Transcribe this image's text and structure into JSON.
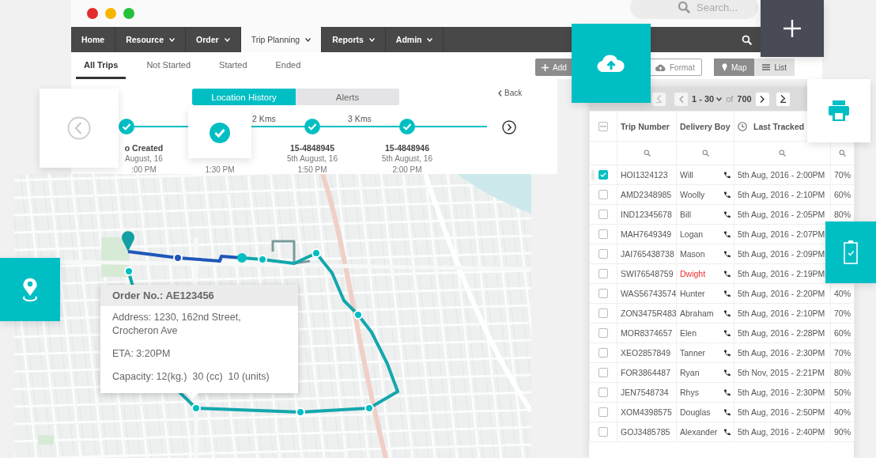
{
  "window": {
    "search": {
      "placeholder": "Search..."
    }
  },
  "nav": [
    {
      "label": "Home",
      "dropdown": false,
      "selected": false
    },
    {
      "label": "Resource",
      "dropdown": true,
      "selected": false
    },
    {
      "label": "Order",
      "dropdown": true,
      "selected": false
    },
    {
      "label": "Trip Planning",
      "dropdown": true,
      "selected": true
    },
    {
      "label": "Reports",
      "dropdown": true,
      "selected": false
    },
    {
      "label": "Admin",
      "dropdown": true,
      "selected": false
    }
  ],
  "sub_tabs": [
    {
      "label": "All Trips",
      "selected": true
    },
    {
      "label": "Not Started",
      "selected": false
    },
    {
      "label": "Started",
      "selected": false
    },
    {
      "label": "Ended",
      "selected": false
    }
  ],
  "toolbar": {
    "buttons": [
      {
        "label": "Add",
        "kind": "add"
      },
      {
        "label": "Format",
        "kind": "format"
      }
    ],
    "view_toggle": [
      {
        "label": "Map",
        "selected": true
      },
      {
        "label": "List",
        "selected": false
      }
    ]
  },
  "timeline": {
    "tabs": [
      {
        "label": "Location History",
        "selected": true
      },
      {
        "label": "Alerts",
        "selected": false
      }
    ],
    "back": "Back",
    "distances": [
      "2 Kms",
      "3 Kms"
    ],
    "stops": [
      {
        "title": "o Created",
        "date": "August, 16",
        "time": ":00 PM",
        "done": true
      },
      {
        "time": "1:30 PM"
      },
      {
        "title": "15-4848945",
        "date": "5th August, 16",
        "time": "1:50 PM",
        "done": true
      },
      {
        "title": "15-4848946",
        "date": "5th August, 16",
        "time": "2:00 PM",
        "done": true
      }
    ]
  },
  "tooltip": {
    "title": "Order No.: AE123456",
    "lines": [
      "Address: 1230, 162nd Street, Crocheron Ave",
      "ETA: 3:20PM",
      "Capacity: 12(kg.)  30 (cc)  10 (units)"
    ]
  },
  "table": {
    "pagination": {
      "range": "1 - 30",
      "of": "of",
      "total": "700"
    },
    "select_all_partial": true,
    "columns": [
      "Trip Number",
      "Delivery Boy",
      "Last Tracked"
    ],
    "rows": [
      {
        "trip": "HOI1324123",
        "boy": "Will",
        "alert": false,
        "tracked": "5th Aug, 2016 - 2:00PM",
        "percent": "70%",
        "selected": true
      },
      {
        "trip": "AMD2348985",
        "boy": "Woolly",
        "alert": false,
        "tracked": "5th Aug, 2016 - 2:10PM",
        "percent": "60%",
        "selected": false
      },
      {
        "trip": "IND12345678",
        "boy": "Bill",
        "alert": false,
        "tracked": "5th Aug, 2016 - 2:05PM",
        "percent": "80%",
        "selected": false
      },
      {
        "trip": "MAH7649349",
        "boy": "Logan",
        "alert": false,
        "tracked": "5th Aug, 2016 - 2:07PM",
        "selected": false
      },
      {
        "trip": "JAI765438738",
        "boy": "Mason",
        "alert": false,
        "tracked": "5th Aug, 2016 - 2:09PM",
        "selected": false
      },
      {
        "trip": "SWI76548759",
        "boy": "Dwight",
        "alert": true,
        "tracked": "5th Aug, 2016 - 2:19PM",
        "selected": false
      },
      {
        "trip": "WAS56743574",
        "boy": "Hunter",
        "alert": false,
        "tracked": "5th Aug, 2016 - 2:20PM",
        "percent": "40%",
        "selected": false
      },
      {
        "trip": "ZON3475R483",
        "boy": "Abraham",
        "alert": false,
        "tracked": "5th Aug, 2016 - 2:10PM",
        "percent": "70%",
        "selected": false
      },
      {
        "trip": "MOR8374657",
        "boy": "Elen",
        "alert": false,
        "tracked": "5th Aug, 2016 - 2:28PM",
        "percent": "60%",
        "selected": false
      },
      {
        "trip": "XEO2857849",
        "boy": "Tanner",
        "alert": false,
        "tracked": "5th Aug, 2016 - 2:30PM",
        "percent": "70%",
        "selected": false
      },
      {
        "trip": "FOR3864487",
        "boy": "Ryan",
        "alert": false,
        "tracked": "5th Nov, 2015 - 2:21PM",
        "percent": "80%",
        "selected": false
      },
      {
        "trip": "JEN7548734",
        "boy": "Rhys",
        "alert": false,
        "tracked": "5th Aug, 2016 - 2:30PM",
        "percent": "50%",
        "selected": false
      },
      {
        "trip": "XOM4398575",
        "boy": "Douglas",
        "alert": false,
        "tracked": "5th Aug, 2016 - 2:50PM",
        "percent": "40%",
        "selected": false
      },
      {
        "trip": "GOJ3485785",
        "boy": "Alexander",
        "alert": false,
        "tracked": "5th Aug, 2016 - 2:40PM",
        "percent": "90%",
        "selected": false
      }
    ]
  }
}
